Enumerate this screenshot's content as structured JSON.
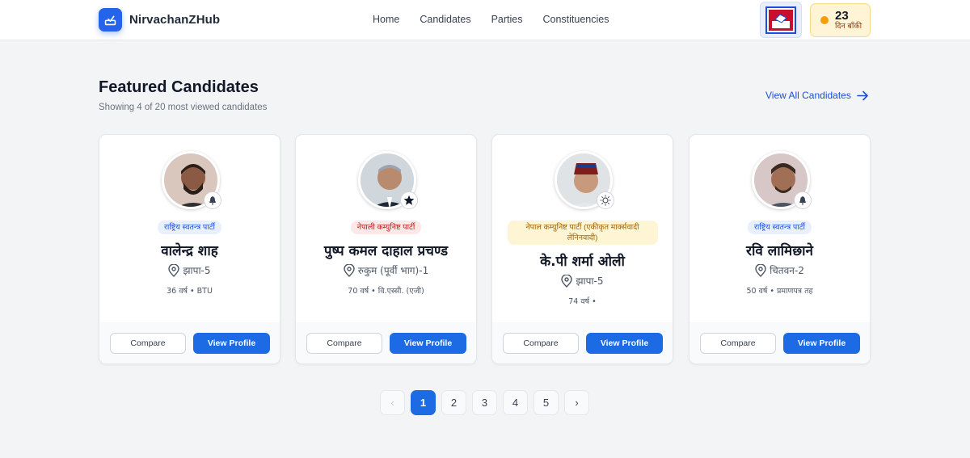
{
  "brand": {
    "name": "NirvachanZHub"
  },
  "nav": {
    "items": [
      "Home",
      "Candidates",
      "Parties",
      "Constituencies"
    ]
  },
  "countdown": {
    "number": "23",
    "label": "दिन बाँकी"
  },
  "section": {
    "title": "Featured Candidates",
    "subtitle": "Showing 4 of 20 most viewed candidates",
    "view_all": "View All Candidates"
  },
  "candidates": [
    {
      "party": "राष्ट्रिय स्वतन्त्र पार्टी",
      "name": "वालेन्द्र शाह",
      "location": "झापा-5",
      "meta": "36 वर्ष • BTU",
      "symbol": "bell-icon",
      "tag_color": "#1d4ed8",
      "compare_label": "Compare",
      "profile_label": "View Profile"
    },
    {
      "party": "नेपाली कम्युनिष्ट पार्टी",
      "name": "पुष्प कमल दाहाल प्रचण्ड",
      "location": "रुकुम (पूर्वी भाग)-1",
      "meta": "70 वर्ष • वि.एस्सी. (एजी)",
      "symbol": "star-icon",
      "tag_color": "#b91c1c",
      "compare_label": "Compare",
      "profile_label": "View Profile"
    },
    {
      "party": "नेपाल कम्युनिष्ट पार्टी (एकीकृत मार्क्सवादी लेनिनवादी)",
      "name": "के.पी शर्मा ओली",
      "location": "झापा-5",
      "meta": "74 वर्ष •",
      "symbol": "sun-icon",
      "tag_color": "#a16207",
      "compare_label": "Compare",
      "profile_label": "View Profile"
    },
    {
      "party": "राष्ट्रिय स्वतन्त्र पार्टी",
      "name": "रवि लामिछाने",
      "location": "चितवन-2",
      "meta": "50 वर्ष • प्रमाणपत्र तह",
      "symbol": "bell-icon",
      "tag_color": "#1d4ed8",
      "compare_label": "Compare",
      "profile_label": "View Profile"
    }
  ],
  "pagination": {
    "prev": "‹",
    "pages": [
      "1",
      "2",
      "3",
      "4",
      "5"
    ],
    "current": "1",
    "next": "›"
  },
  "colors": {
    "primary": "#1d6ae5",
    "accent_countdown": "#f59e0b",
    "background": "#f3f4f6"
  }
}
